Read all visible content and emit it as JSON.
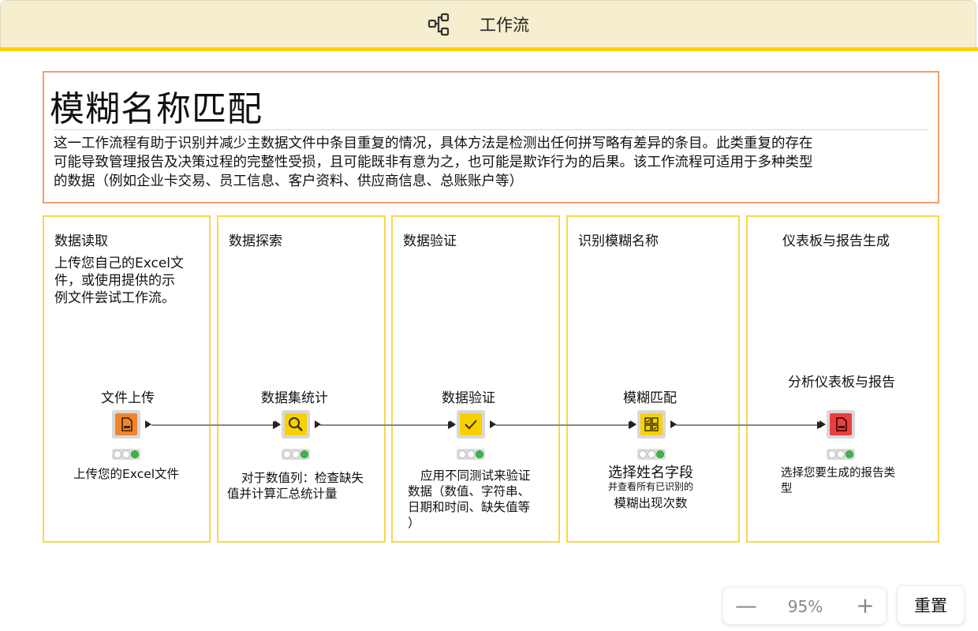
{
  "header": {
    "title": "工作流",
    "icon": "workflow-icon"
  },
  "description": {
    "title": "模糊名称匹配",
    "text_lines": [
      "这一工作流程有助于识别并减少主数据文件中条目重复的情况，具体方法是检测出任何拼写略有差异的条目。此类重复的存在",
      "可能导致管理报告及决策过程的完整性受损，且可能既非有意为之，也可能是欺诈行为的后果。该工作流程可适用于多种类型",
      "的数据（例如企业卡交易、员工信息、客户资料、供应商信息、总账账户等）"
    ]
  },
  "stages": [
    {
      "title": "数据读取",
      "text_lines": [
        "上传您自己的Excel文",
        "件，或使用提供的示",
        "例文件尝试工作流。"
      ]
    },
    {
      "title": "数据探索",
      "text_lines": []
    },
    {
      "title": "数据验证",
      "text_lines": []
    },
    {
      "title": "识别模糊名称",
      "text_lines": []
    },
    {
      "title": "仪表板与报告生成",
      "text_lines": []
    }
  ],
  "nodes": [
    {
      "label": "文件上传",
      "icon": "excel-file-icon",
      "color": "#f0862c",
      "caption_lines": [
        "上传您的Excel文件"
      ]
    },
    {
      "label": "数据集统计",
      "icon": "magnifier-icon",
      "color": "#f7d200",
      "caption_lines": [
        "对于数值列：检查缺失",
        "值并计算汇总统计量"
      ]
    },
    {
      "label": "数据验证",
      "icon": "checkmark-icon",
      "color": "#f7d200",
      "caption_lines": [
        "应用不同测试来验证",
        "数据（数值、字符串、",
        "日期和时间、缺失值等",
        "）"
      ]
    },
    {
      "label": "模糊匹配",
      "icon": "grid-check-icon",
      "color": "#f7d200",
      "caption_lines": [
        "选择姓名字段",
        "并查看所有已识别的",
        "模糊出现次数"
      ]
    },
    {
      "label": "分析仪表板与报告",
      "icon": "report-file-icon",
      "color": "#e84040",
      "caption_lines": [
        "选择您要生成的报告类",
        "型"
      ]
    }
  ],
  "zoom": {
    "minus": "—",
    "value": "95%",
    "plus": "+"
  },
  "reset_label": "重置",
  "colors": {
    "header_bg": "#f5efcf",
    "accent_yellow": "#f7d200",
    "desc_border": "#f0a068",
    "stage_border": "#f7d84a",
    "status_green": "#3cb64a"
  }
}
